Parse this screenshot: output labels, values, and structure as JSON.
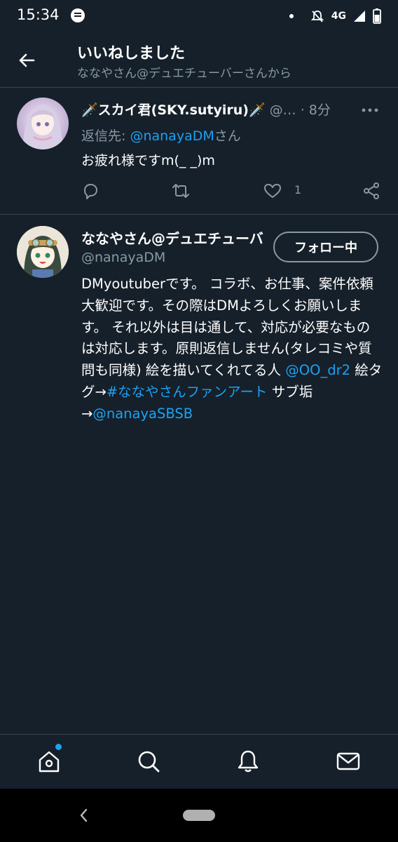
{
  "status_bar": {
    "time": "15:34",
    "network": "4G",
    "icons": [
      "message-icon",
      "notification-dot",
      "mute-icon",
      "signal-icon",
      "battery-icon"
    ]
  },
  "header": {
    "title": "いいねしました",
    "subtitle": "ななやさん@デュエチューバーさんから"
  },
  "reply_tweet": {
    "display_name": "🗡️スカイ君(SKY.sutyiru)🗡️",
    "meta": " @… · 8分",
    "reply_to_prefix": "返信先: ",
    "reply_to_handle": "@nanayaDM",
    "reply_to_suffix": "さん",
    "text": "お疲れ様ですm(_ _)m",
    "like_count": "1"
  },
  "profile": {
    "display_name": "ななやさん@デュエチューバー",
    "handle": "@nanayaDM",
    "follow_label": "フォロー中",
    "bio_part1": "DMyoutuberです。 コラボ、お仕事、案件依頼大歓迎です。その際はDMよろしくお願いします。 それ以外は目は通して、対応が必要なものは対応します。原則返信しません(タレコミや質問も同様) 絵を描いてくれてる人 ",
    "bio_link1": "@OO_dr2",
    "bio_part2": " 絵タグ→",
    "bio_link2": "#ななやさんファンアート",
    "bio_part3": " サブ垢→",
    "bio_link3": "@nanayaSBSB"
  },
  "colors": {
    "background": "#15202b",
    "accent": "#1da1f2",
    "secondary_text": "#8899a6",
    "divider": "#38444d"
  }
}
